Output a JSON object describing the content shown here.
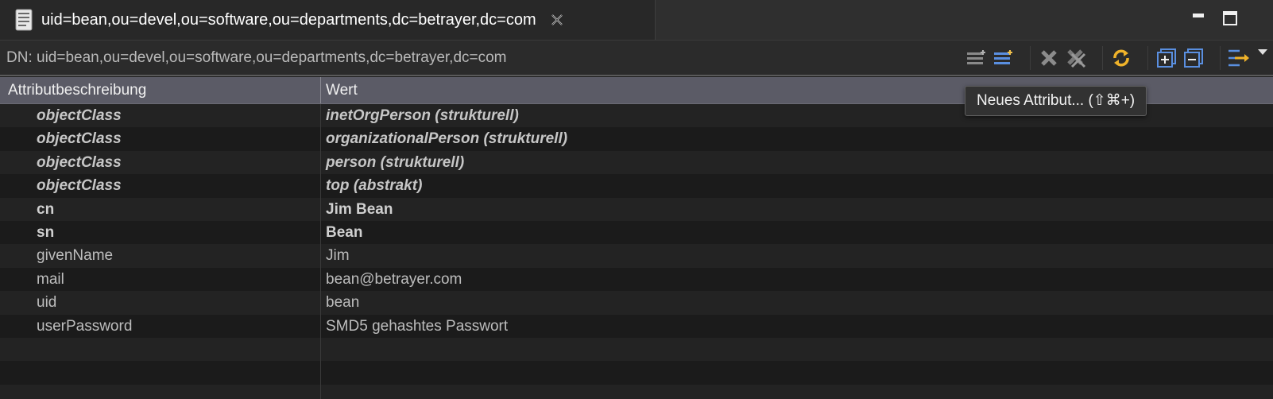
{
  "tab": {
    "title": "uid=bean,ou=devel,ou=software,ou=departments,dc=betrayer,dc=com",
    "icon": "entry-document-icon"
  },
  "dn_bar": {
    "label": "DN: uid=bean,ou=devel,ou=software,ou=departments,dc=betrayer,dc=com"
  },
  "toolbar": {
    "buttons": [
      {
        "name": "new-value-button",
        "icon": "new-value-icon"
      },
      {
        "name": "new-attribute-button",
        "icon": "new-attribute-icon"
      },
      {
        "name": "delete-value-button",
        "icon": "delete-icon"
      },
      {
        "name": "delete-all-button",
        "icon": "delete-all-icon"
      },
      {
        "name": "refresh-button",
        "icon": "refresh-icon"
      },
      {
        "name": "expand-all-button",
        "icon": "expand-all-icon"
      },
      {
        "name": "collapse-all-button",
        "icon": "collapse-all-icon"
      },
      {
        "name": "filter-button",
        "icon": "filter-icon"
      },
      {
        "name": "view-menu-button",
        "icon": "dropdown-triangle-icon"
      }
    ]
  },
  "table": {
    "headers": {
      "attribute": "Attributbeschreibung",
      "value": "Wert"
    },
    "rows": [
      {
        "attribute": "objectClass",
        "value": "inetOrgPerson (strukturell)",
        "style": "ital"
      },
      {
        "attribute": "objectClass",
        "value": "organizationalPerson (strukturell)",
        "style": "ital"
      },
      {
        "attribute": "objectClass",
        "value": "person (strukturell)",
        "style": "ital"
      },
      {
        "attribute": "objectClass",
        "value": "top (abstrakt)",
        "style": "ital"
      },
      {
        "attribute": "cn",
        "value": "Jim Bean",
        "style": "bold"
      },
      {
        "attribute": "sn",
        "value": "Bean",
        "style": "bold"
      },
      {
        "attribute": "givenName",
        "value": "Jim",
        "style": "plain"
      },
      {
        "attribute": "mail",
        "value": "bean@betrayer.com",
        "style": "plain"
      },
      {
        "attribute": "uid",
        "value": "bean",
        "style": "plain"
      },
      {
        "attribute": "userPassword",
        "value": "SMD5 gehashtes Passwort",
        "style": "plain"
      },
      {
        "attribute": "",
        "value": "",
        "style": "plain"
      },
      {
        "attribute": "",
        "value": "",
        "style": "plain"
      },
      {
        "attribute": "",
        "value": "",
        "style": "plain"
      }
    ]
  },
  "tooltip": {
    "text": "Neues Attribut... (⇧⌘+)"
  }
}
